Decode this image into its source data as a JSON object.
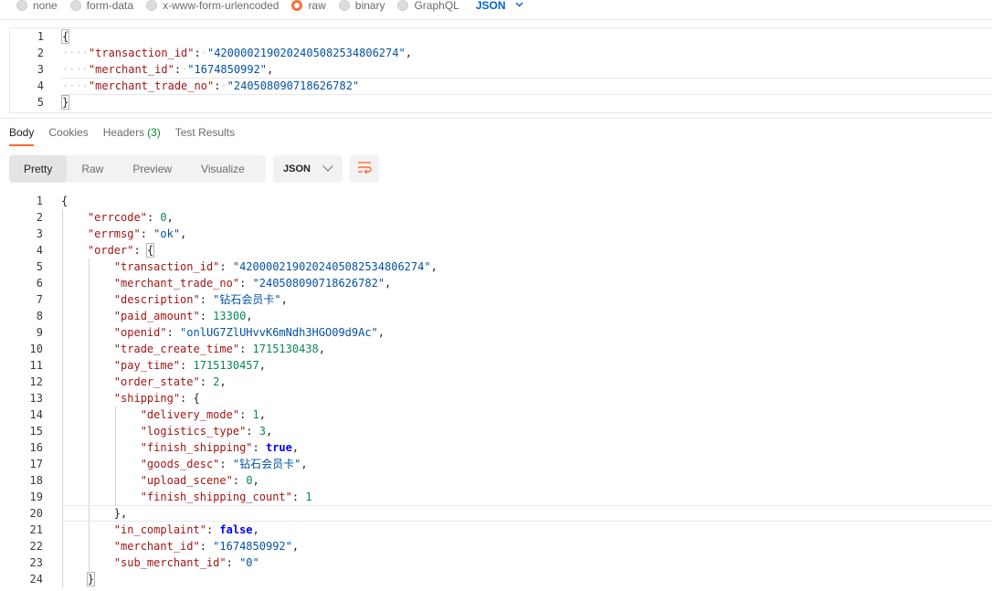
{
  "body_types": {
    "options": [
      {
        "label": "none",
        "selected": false
      },
      {
        "label": "form-data",
        "selected": false
      },
      {
        "label": "x-www-form-urlencoded",
        "selected": false
      },
      {
        "label": "raw",
        "selected": true
      },
      {
        "label": "binary",
        "selected": false
      },
      {
        "label": "GraphQL",
        "selected": false
      }
    ],
    "format": "JSON"
  },
  "request_body": {
    "line_numbers": [
      "1",
      "2",
      "3",
      "4",
      "5"
    ],
    "lines": [
      {
        "open": "{"
      },
      {
        "key": "\"transaction_id\"",
        "value": "\"4200002190202405082534806274\"",
        "trail": ","
      },
      {
        "key": "\"merchant_id\"",
        "value": "\"1674850992\"",
        "trail": ","
      },
      {
        "key": "\"merchant_trade_no\"",
        "value": "\"240508090718626782\""
      },
      {
        "close": "}"
      }
    ]
  },
  "response_tabs": {
    "body": "Body",
    "cookies": "Cookies",
    "headers": "Headers",
    "headers_count": "(3)",
    "test_results": "Test Results"
  },
  "view_modes": {
    "pretty": "Pretty",
    "raw": "Raw",
    "preview": "Preview",
    "visualize": "Visualize",
    "active": "Pretty"
  },
  "language": "JSON",
  "icons": {
    "wrap": "wrap-lines-icon",
    "dropdown": "chevron-down-icon"
  },
  "colors": {
    "accent": "#ff6c37",
    "json_key": "#a31515",
    "json_string": "#0451a5",
    "json_number": "#098658",
    "json_boolean": "#0000ff"
  },
  "response_body": {
    "line_numbers": [
      "1",
      "2",
      "3",
      "4",
      "5",
      "6",
      "7",
      "8",
      "9",
      "10",
      "11",
      "12",
      "13",
      "14",
      "15",
      "16",
      "17",
      "18",
      "19",
      "20",
      "21",
      "22",
      "23",
      "24"
    ],
    "lines": [
      {
        "punct": "{"
      },
      {
        "key": "\"errcode\"",
        "num": "0",
        "trail": ","
      },
      {
        "key": "\"errmsg\"",
        "str": "\"ok\"",
        "trail": ","
      },
      {
        "key": "\"order\"",
        "punct": "{"
      },
      {
        "key": "\"transaction_id\"",
        "str": "\"4200002190202405082534806274\"",
        "trail": ","
      },
      {
        "key": "\"merchant_trade_no\"",
        "str": "\"240508090718626782\"",
        "trail": ","
      },
      {
        "key": "\"description\"",
        "str": "\"钻石会员卡\"",
        "trail": ","
      },
      {
        "key": "\"paid_amount\"",
        "num": "13300",
        "trail": ","
      },
      {
        "key": "\"openid\"",
        "str": "\"onlUG7ZlUHvvK6mNdh3HGO09d9Ac\"",
        "trail": ","
      },
      {
        "key": "\"trade_create_time\"",
        "num": "1715130438",
        "trail": ","
      },
      {
        "key": "\"pay_time\"",
        "num": "1715130457",
        "trail": ","
      },
      {
        "key": "\"order_state\"",
        "num": "2",
        "trail": ","
      },
      {
        "key": "\"shipping\"",
        "punct": "{"
      },
      {
        "key": "\"delivery_mode\"",
        "num": "1",
        "trail": ","
      },
      {
        "key": "\"logistics_type\"",
        "num": "3",
        "trail": ","
      },
      {
        "key": "\"finish_shipping\"",
        "bool": "true",
        "trail": ","
      },
      {
        "key": "\"goods_desc\"",
        "str": "\"钻石会员卡\"",
        "trail": ","
      },
      {
        "key": "\"upload_scene\"",
        "num": "0",
        "trail": ","
      },
      {
        "key": "\"finish_shipping_count\"",
        "num": "1"
      },
      {
        "punct": "},"
      },
      {
        "key": "\"in_complaint\"",
        "bool": "false",
        "trail": ","
      },
      {
        "key": "\"merchant_id\"",
        "str": "\"1674850992\"",
        "trail": ","
      },
      {
        "key": "\"sub_merchant_id\"",
        "str": "\"0\""
      },
      {
        "punct": "}"
      }
    ]
  }
}
